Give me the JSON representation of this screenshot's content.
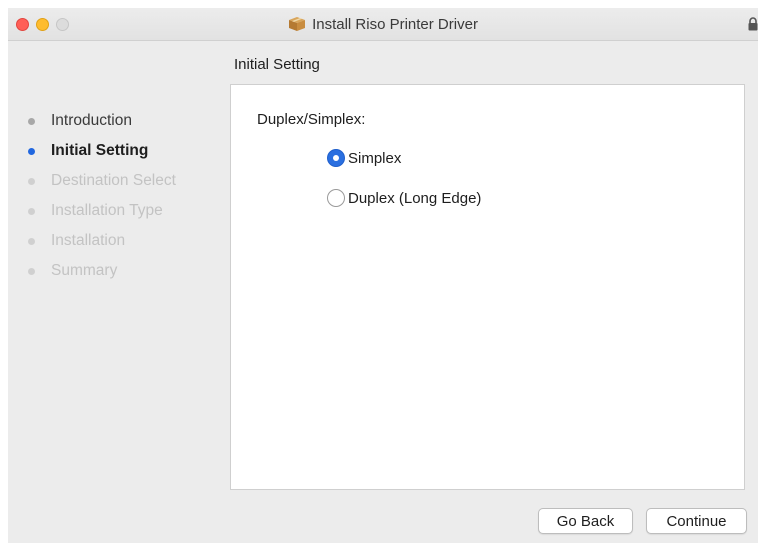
{
  "window": {
    "title": "Install Riso Printer Driver",
    "title_icon": "package-icon",
    "lock_icon": "lock-icon"
  },
  "step_heading": "Initial Setting",
  "sidebar": {
    "items": [
      {
        "label": "Introduction",
        "state": "done"
      },
      {
        "label": "Initial Setting",
        "state": "active"
      },
      {
        "label": "Destination Select",
        "state": "pending"
      },
      {
        "label": "Installation Type",
        "state": "pending"
      },
      {
        "label": "Installation",
        "state": "pending"
      },
      {
        "label": "Summary",
        "state": "pending"
      }
    ]
  },
  "content": {
    "field_label": "Duplex/Simplex:",
    "options": [
      {
        "label": "Simplex",
        "checked": true
      },
      {
        "label": "Duplex (Long Edge)",
        "checked": false
      }
    ]
  },
  "buttons": {
    "back_label": "Go Back",
    "continue_label": "Continue"
  },
  "colors": {
    "accent": "#2a6fe0",
    "active_step_dot": "#2167df",
    "close": "#ff5f57",
    "minimize": "#febc2e"
  }
}
